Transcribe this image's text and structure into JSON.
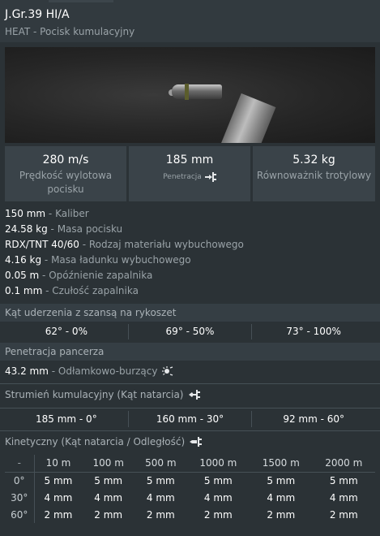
{
  "header": {
    "title": "J.Gr.39 HI/A",
    "subtitle": "HEAT - Pocisk kumulacyjny"
  },
  "stats": [
    {
      "value": "280 m/s",
      "label": "Prędkość wylotowa pocisku"
    },
    {
      "value": "185 mm",
      "label": "Penetracja"
    },
    {
      "value": "5.32 kg",
      "label": "Równoważnik trotylowy"
    }
  ],
  "info": [
    {
      "value": "150 mm",
      "desc": " - Kaliber"
    },
    {
      "value": "24.58 kg",
      "desc": " - Masa pocisku"
    },
    {
      "value": "RDX/TNT 40/60",
      "desc": " - Rodzaj materiału wybuchowego"
    },
    {
      "value": "4.16 kg",
      "desc": " - Masa ładunku wybuchowego"
    },
    {
      "value": "0.05 m",
      "desc": " - Opóźnienie zapalnika"
    },
    {
      "value": "0.1 mm",
      "desc": " - Czułość zapalnika"
    }
  ],
  "ricochet": {
    "title": "Kąt uderzenia z szansą na rykoszet",
    "cells": [
      "62° - 0%",
      "69° - 50%",
      "73° - 100%"
    ]
  },
  "armor": {
    "title": "Penetracja pancerza",
    "he_value": "43.2 mm",
    "he_desc": " - Odłamkowo-burzący"
  },
  "jet": {
    "title": "Strumień kumulacyjny (Kąt natarcia)",
    "cells": [
      {
        "value": "185 mm",
        "angle": " - 0°"
      },
      {
        "value": "160 mm",
        "angle": " - 30°"
      },
      {
        "value": "92 mm",
        "angle": " - 60°"
      }
    ]
  },
  "kinetic": {
    "title": "Kinetyczny (Kąt natarcia / Odległość)",
    "corner": "-",
    "distances": [
      "10 m",
      "100 m",
      "500 m",
      "1000 m",
      "1500 m",
      "2000 m"
    ],
    "rows": [
      {
        "angle": "0°",
        "values": [
          "5 mm",
          "5 mm",
          "5 mm",
          "5 mm",
          "5 mm",
          "5 mm"
        ]
      },
      {
        "angle": "30°",
        "values": [
          "4 mm",
          "4 mm",
          "4 mm",
          "4 mm",
          "4 mm",
          "4 mm"
        ]
      },
      {
        "angle": "60°",
        "values": [
          "2 mm",
          "2 mm",
          "2 mm",
          "2 mm",
          "2 mm",
          "2 mm"
        ]
      }
    ]
  },
  "icons": [
    "penetration-icon",
    "he-burst-icon",
    "heat-jet-icon",
    "kinetic-shell-icon"
  ]
}
